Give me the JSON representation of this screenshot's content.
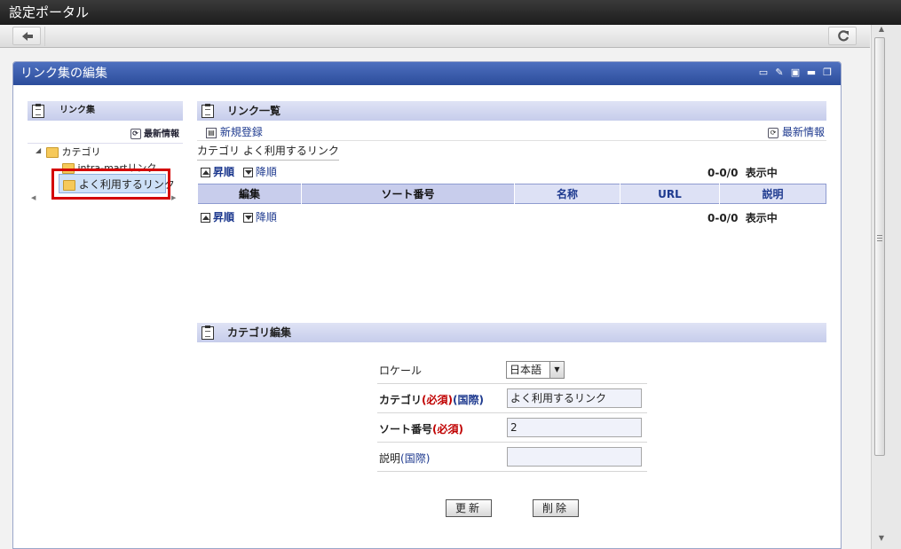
{
  "window": {
    "title": "設定ポータル"
  },
  "portlet": {
    "title": "リンク集の編集"
  },
  "tree": {
    "header": "リンク集",
    "latest": "最新情報",
    "root": "カテゴリ",
    "children": [
      "intra-martリンク",
      "よく利用するリンク"
    ]
  },
  "list": {
    "header": "リンク一覧",
    "new_entry": "新規登録",
    "latest": "最新情報",
    "breadcrumb": "カテゴリ よく利用するリンク",
    "sort_asc": "昇順",
    "sort_desc": "降順",
    "count": "0-0/0",
    "count_label": "表示中",
    "columns": [
      "編集",
      "ソート番号",
      "名称",
      "URL",
      "説明"
    ]
  },
  "form": {
    "header": "カテゴリ編集",
    "locale_label": "ロケール",
    "locale_value": "日本語",
    "category_label": "カテゴリ",
    "required": "(必須)",
    "international": "(国際)",
    "category_value": "よく利用するリンク",
    "sort_label": "ソート番号",
    "sort_value": "2",
    "description_label": "説明",
    "description_value": "",
    "update_button": "更新",
    "delete_button": "削除"
  }
}
